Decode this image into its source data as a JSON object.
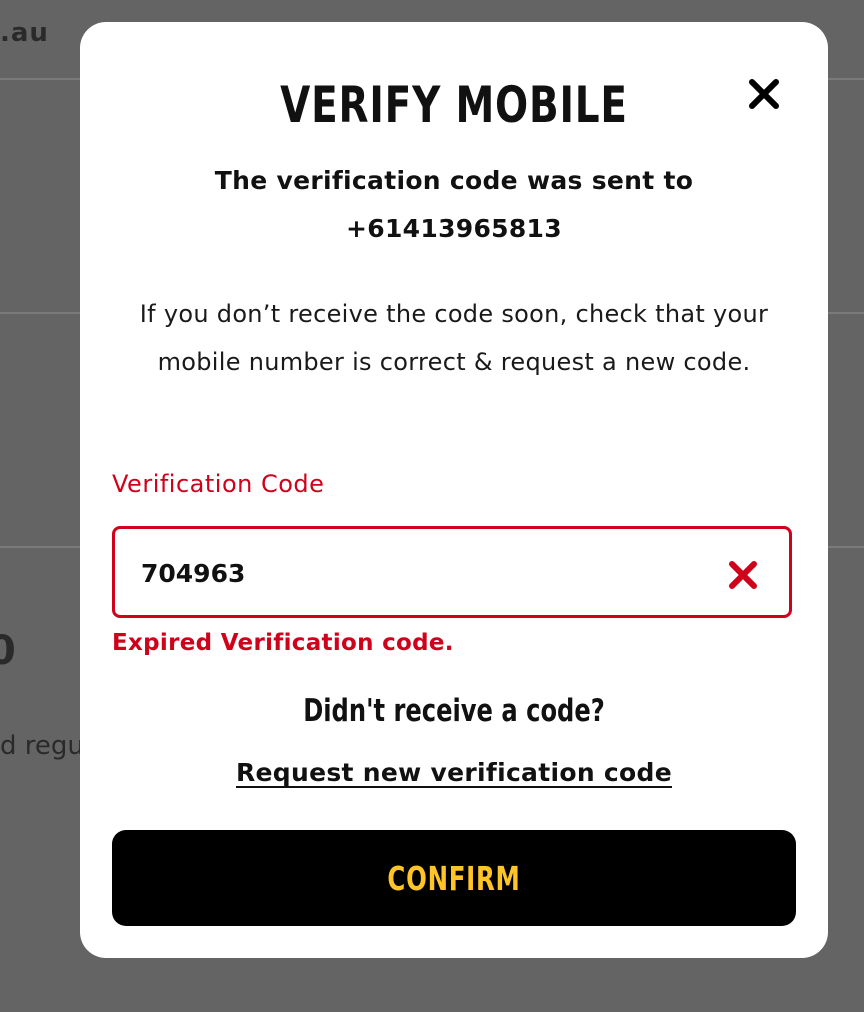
{
  "background": {
    "domain_fragment": ".au",
    "partial_number": "0",
    "partial_text": "d regu"
  },
  "modal": {
    "title": "VERIFY MOBILE",
    "close_icon": "close-icon",
    "sent_message": "The verification code was sent to",
    "phone_number": "+61413965813",
    "info_text": "If you don’t receive the code soon, check that your mobile number is correct & request a new code.",
    "field_label": "Verification Code",
    "code_value": "704963",
    "clear_icon": "clear-icon",
    "error_message": "Expired Verification code.",
    "didnt_receive": "Didn't receive a code?",
    "request_link": "Request new verification code",
    "confirm_label": "CONFIRM"
  },
  "colors": {
    "overlay": "#646464",
    "error_red": "#d0021b",
    "button_bg": "#000000",
    "button_text": "#ffc425",
    "text": "#111111"
  }
}
